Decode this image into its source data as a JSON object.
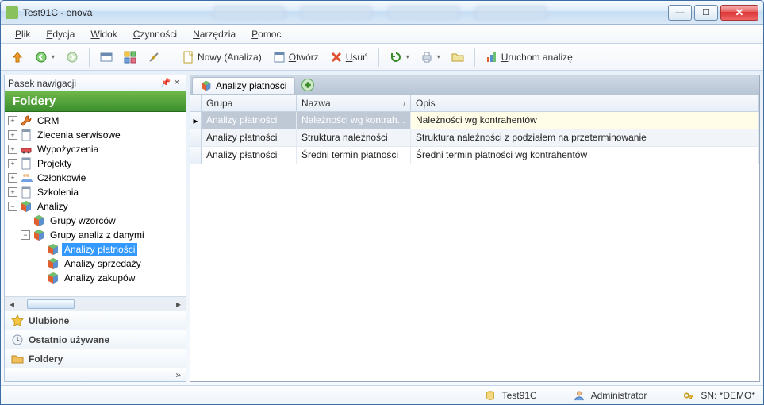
{
  "window": {
    "title": "Test91C - enova"
  },
  "menu": {
    "plik": "Plik",
    "edycja": "Edycja",
    "widok": "Widok",
    "czynnosci": "Czynności",
    "narzedzia": "Narzędzia",
    "pomoc": "Pomoc"
  },
  "toolbar": {
    "nowy": "Nowy (Analiza)",
    "otworz": "Otwórz",
    "usun": "Usuń",
    "uruchom": "Uruchom analizę"
  },
  "sidebar": {
    "pane_title": "Pasek nawigacji",
    "foldery_header": "Foldery",
    "tree": [
      {
        "label": "CRM",
        "depth": 0,
        "exp": "+",
        "icon": "wrench"
      },
      {
        "label": "Zlecenia serwisowe",
        "depth": 0,
        "exp": "+",
        "icon": "doc"
      },
      {
        "label": "Wypożyczenia",
        "depth": 0,
        "exp": "+",
        "icon": "car"
      },
      {
        "label": "Projekty",
        "depth": 0,
        "exp": "+",
        "icon": "doc"
      },
      {
        "label": "Członkowie",
        "depth": 0,
        "exp": "+",
        "icon": "people"
      },
      {
        "label": "Szkolenia",
        "depth": 0,
        "exp": "+",
        "icon": "doc"
      },
      {
        "label": "Analizy",
        "depth": 0,
        "exp": "-",
        "icon": "cube"
      },
      {
        "label": "Grupy wzorców",
        "depth": 1,
        "exp": "",
        "icon": "cube"
      },
      {
        "label": "Grupy analiz z danymi",
        "depth": 1,
        "exp": "-",
        "icon": "cube"
      },
      {
        "label": "Analizy płatności",
        "depth": 2,
        "exp": "",
        "icon": "cube",
        "selected": true
      },
      {
        "label": "Analizy sprzedaży",
        "depth": 2,
        "exp": "",
        "icon": "cube"
      },
      {
        "label": "Analizy zakupów",
        "depth": 2,
        "exp": "",
        "icon": "cube"
      }
    ],
    "accordion": {
      "ulubione": "Ulubione",
      "ostatnio": "Ostatnio używane",
      "foldery": "Foldery"
    }
  },
  "tab": {
    "title": "Analizy płatności"
  },
  "grid": {
    "headers": {
      "grupa": "Grupa",
      "nazwa": "Nazwa",
      "opis": "Opis"
    },
    "sort_indicator": "/",
    "rows": [
      {
        "grupa": "Analizy płatności",
        "nazwa": "Należności wg kontrah...",
        "opis": "Należności wg kontrahentów"
      },
      {
        "grupa": "Analizy płatności",
        "nazwa": "Struktura należności",
        "opis": "Struktura należności z podziałem na przeterminowanie"
      },
      {
        "grupa": "Analizy płatności",
        "nazwa": "Średni termin płatności",
        "opis": "Średni termin płatności wg kontrahentów"
      }
    ]
  },
  "status": {
    "db": "Test91C",
    "user": "Administrator",
    "sn": "SN: *DEMO*"
  }
}
